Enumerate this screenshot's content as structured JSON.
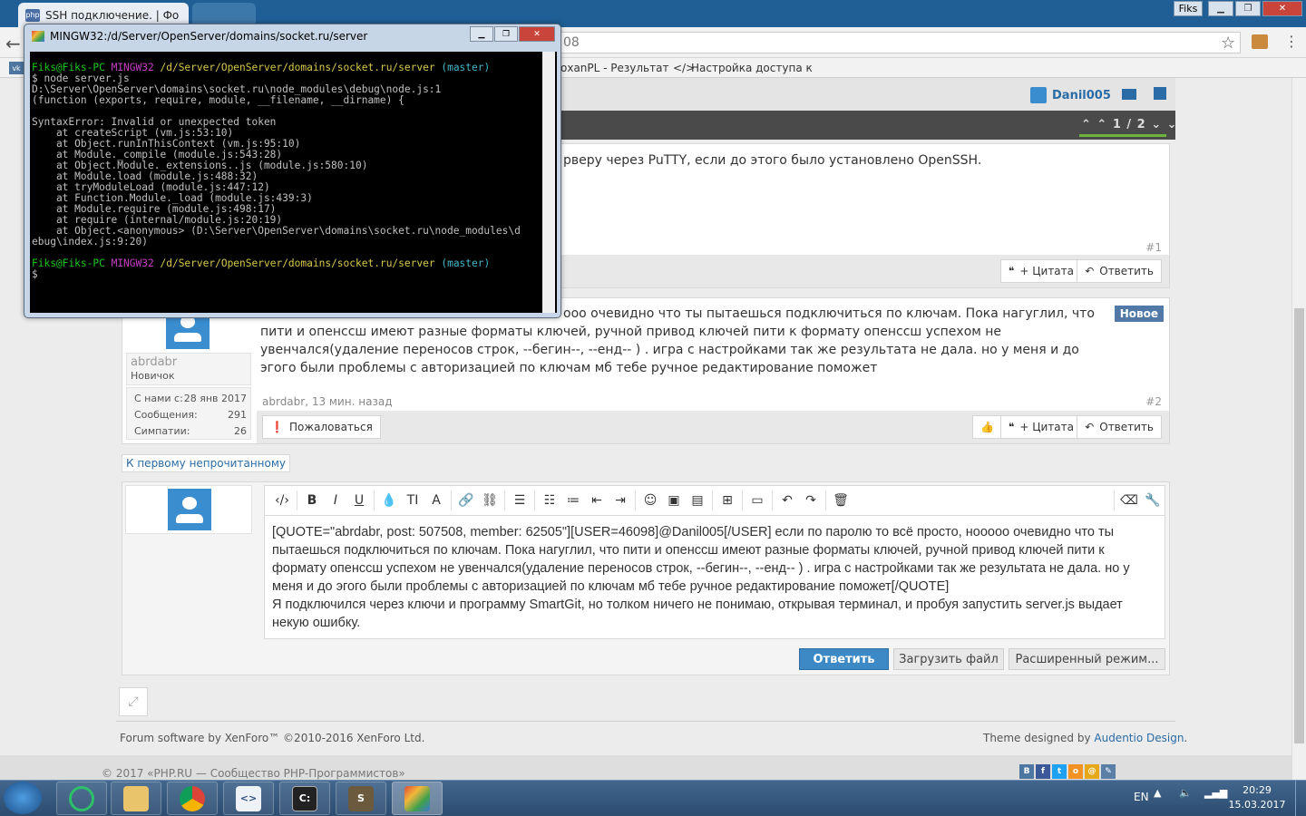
{
  "browser": {
    "tabs": [
      {
        "label": "SSH подключение. | Фо",
        "favicon": "php"
      },
      {
        "label": ""
      }
    ],
    "profile_chip": "Fiks",
    "address": "08",
    "bookmarks": [
      "охаnPL - Результат",
      "Настройка доступа к"
    ],
    "vk_icon": "vk"
  },
  "forum": {
    "user_nav": {
      "username": "Danil005"
    },
    "pager": "⌃ ⌃ 1 / 2 ⌄ ⌄",
    "posts": [
      {
        "text": "рверу через PuTTY, если до этого было установлено OpenSSH.",
        "number": "#1",
        "actions": {
          "quote": "+ Цитата",
          "reply": "Ответить"
        }
      },
      {
        "badge": "Новое",
        "text": "ооо очевидно что ты пытаешься подключиться по ключам. Пока нагуглил, что пити и опенссш имеют разные форматы ключей, ручной привод ключей пити к формату опенссш успехом не увенчался(удаление переносов строк, --бегин--, --енд-- ) . игра с настройками так же результата не дала. но у меня и до эгого были проблемы с авторизацией по ключам мб тебе ручное редактирование поможет",
        "author": "abrdabr",
        "role": "Новичок",
        "meta": "abrdabr, 13 мин. назад",
        "number": "#2",
        "stats": [
          {
            "label": "С нами с:",
            "value": "28 янв 2017"
          },
          {
            "label": "Сообщения:",
            "value": "291"
          },
          {
            "label": "Симпатии:",
            "value": "26"
          }
        ],
        "actions": {
          "report": "Пожаловаться",
          "quote": "+ Цитата",
          "reply": "Ответить"
        }
      }
    ],
    "unread_link": "К первому непрочитанному",
    "editor": {
      "content": "[QUOTE=\"abrdabr, post: 507508, member: 62505\"][USER=46098]@Danil005[/USER] если по паролю то всё просто, нооооо очевидно что ты пытаешься подключиться по ключам. Пока нагуглил, что пити и опенссш имеют разные форматы ключей, ручной привод ключей пити к формату опенссш успехом не увенчался(удаление переносов строк, --бегин--, --енд-- ) . игра с настройками так же результата не дала. но у меня и до эгого были проблемы с авторизацией по ключам мб тебе ручное редактирование поможет[/QUOTE]",
      "content2": "Я подключился через ключи и программу SmartGit, но толком ничего не понимаю, открывая терминал, и пробуя запустить server.js выдает некую ошибку.",
      "reply_label": "Ответить",
      "upload_label": "Загрузить файл",
      "advanced_label": "Расширенный режим..."
    },
    "footer": {
      "left": "Forum software by XenForo™ ©2010-2016 XenForo Ltd.",
      "right_prefix": "Theme designed by ",
      "right_link": "Audentio Design",
      "right_suffix": ".",
      "copyright": "© 2017 «PHP.RU — Сообщество PHP-Программистов»"
    }
  },
  "terminal": {
    "title": "MINGW32:/d/Server/OpenServer/domains/socket.ru/server",
    "prompt_user": "Fiks@Fiks-PC",
    "prompt_env": "MINGW32",
    "prompt_path": "/d/Server/OpenServer/domains/socket.ru/server",
    "prompt_branch": "(master)",
    "lines": [
      "$ node server.js",
      "D:\\Server\\OpenServer\\domains\\socket.ru\\node_modules\\debug\\node.js:1",
      "(function (exports, require, module, __filename, __dirname) {",
      "",
      "SyntaxError: Invalid or unexpected token",
      "    at createScript (vm.js:53:10)",
      "    at Object.runInThisContext (vm.js:95:10)",
      "    at Module._compile (module.js:543:28)",
      "    at Object.Module._extensions..js (module.js:580:10)",
      "    at Module.load (module.js:488:32)",
      "    at tryModuleLoad (module.js:447:12)",
      "    at Function.Module._load (module.js:439:3)",
      "    at Module.require (module.js:498:17)",
      "    at require (internal/module.js:20:19)",
      "    at Object.<anonymous> (D:\\Server\\OpenServer\\domains\\socket.ru\\node_modules\\d",
      "ebug\\index.js:9:20)",
      ""
    ],
    "last_prompt": "$"
  },
  "taskbar": {
    "lang": "EN",
    "time": "20:29",
    "date": "15.03.2017"
  }
}
